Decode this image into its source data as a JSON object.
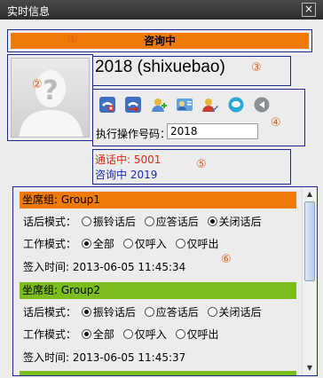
{
  "window": {
    "title": "实时信息",
    "close_icon": "close-icon"
  },
  "markers": [
    "①",
    "②",
    "③",
    "④",
    "⑤",
    "⑥"
  ],
  "status": {
    "label": "咨询中",
    "color": "#f07a08"
  },
  "avatar": {
    "icon": "unknown-person-icon"
  },
  "agent": {
    "name": "2018 (shixuebao)"
  },
  "toolbar": {
    "icons": [
      "hangup-phone-icon",
      "transfer-phone-icon",
      "add-user-icon",
      "user-card-icon",
      "user-edit-icon",
      "chat-bubble-icon",
      "back-arrow-icon"
    ],
    "exec_label": "执行操作号码：",
    "exec_value": "2018"
  },
  "calls": {
    "line1": "通话中: 5001",
    "line2": "咨询中  2019"
  },
  "groups": [
    {
      "header": "坐席组: Group1",
      "header_color": "#f07a08",
      "after_call_label": "话后模式：",
      "after_call_options": [
        "振铃话后",
        "应答话后",
        "关闭话后"
      ],
      "after_call_selected": 2,
      "work_label": "工作模式：",
      "work_options": [
        "全部",
        "仅呼入",
        "仅呼出"
      ],
      "work_selected": 0,
      "signin_label": "签入时间: 2013-06-05 11:45:34"
    },
    {
      "header": "坐席组: Group2",
      "header_color": "#7cbd1e",
      "after_call_label": "话后模式：",
      "after_call_options": [
        "振铃话后",
        "应答话后",
        "关闭话后"
      ],
      "after_call_selected": 0,
      "work_label": "工作模式：",
      "work_options": [
        "全部",
        "仅呼入",
        "仅呼出"
      ],
      "work_selected": 0,
      "signin_label": "签入时间: 2013-06-05 11:45:37"
    }
  ],
  "next_group_color": "#7cbd1e"
}
